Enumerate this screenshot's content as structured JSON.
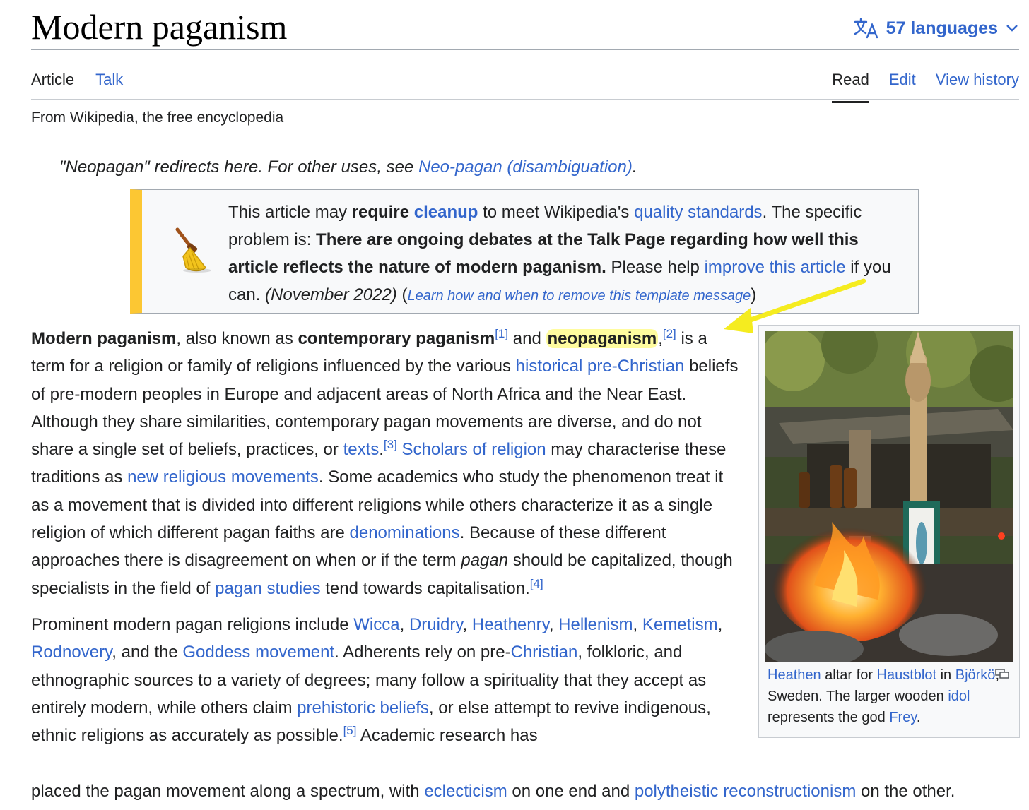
{
  "header": {
    "title": "Modern paganism",
    "languages_label": "57 languages"
  },
  "tabs": {
    "article": "Article",
    "talk": "Talk",
    "read": "Read",
    "edit": "Edit",
    "view_history": "View history"
  },
  "tagline": "From Wikipedia, the free encyclopedia",
  "hatnote": {
    "text": "\"Neopagan\" redirects here. For other uses, see ",
    "link": "Neo-pagan (disambiguation)",
    "end": "."
  },
  "ambox": {
    "t1": "This article may ",
    "b1": "require ",
    "l1": "cleanup",
    "t2": " to meet Wikipedia's ",
    "l2": "quality standards",
    "t3": ". The specific problem is: ",
    "b2": "There are ongoing debates at the Talk Page regarding how well this article reflects the nature of modern paganism.",
    "t4": " Please help ",
    "l3": "improve this article",
    "t5": " if you can. ",
    "date": "(November 2022)",
    "t6": " (",
    "l4": "Learn how and when to remove this template message",
    "t7": ")"
  },
  "p1": {
    "b1": "Modern paganism",
    "t1": ", also known as ",
    "b2": "contemporary paganism",
    "r1": "[1]",
    "t2": " and ",
    "b3": "neopaganism",
    "t3": ",",
    "r2": "[2]",
    "t4": " is a term for a religion or family of religions influenced by the various ",
    "l1": "historical pre-Christian",
    "t5": " beliefs of pre-modern peoples in Europe and adjacent areas of North Africa and the Near East. Although they share similarities, contemporary pagan movements are diverse, and do not share a single set of beliefs, practices, or ",
    "l2": "texts",
    "t6": ".",
    "r3": "[3]",
    "t7": " ",
    "l3": "Scholars of religion",
    "t8": " may characterise these traditions as ",
    "l4": "new religious movements",
    "t9": ". Some academics who study the phenomenon treat it as a movement that is divided into different religions while others characterize it as a single religion of which different pagan faiths are ",
    "l5": "denominations",
    "t10": ". Because of these different approaches there is disagreement on when or if the term ",
    "i1": "pagan",
    "t11": " should be capitalized, though specialists in the field of ",
    "l6": "pagan studies",
    "t12": " tend towards capitalisation.",
    "r4": "[4]"
  },
  "p2": {
    "t1": "Prominent modern pagan religions include ",
    "l1": "Wicca",
    "c1": ", ",
    "l2": "Druidry",
    "c2": ", ",
    "l3": "Heathenry",
    "c3": ", ",
    "l4": "Hellenism",
    "c4": ", ",
    "l5": "Kemetism",
    "c5": ", ",
    "l6": "Rodnovery",
    "t2": ", and the ",
    "l7": "Goddess movement",
    "t3": ". Adherents rely on pre-",
    "l8": "Christian",
    "t4": ", folkloric, and ethnographic sources to a variety of degrees; many follow a spirituality that they accept as entirely modern, while others claim ",
    "l9": "prehistoric beliefs",
    "t5": ", or else attempt to revive indigenous, ethnic religions as accurately as possible.",
    "r1": "[5]",
    "t6": " Academic research has"
  },
  "p3": {
    "t1": "placed the pagan movement along a spectrum, with ",
    "l1": "eclecticism",
    "t2": " on one end and ",
    "l2": "polytheistic reconstructionism",
    "t3": " on the other."
  },
  "infobox": {
    "l1": "Heathen",
    "t1": " altar for ",
    "l2": "Haustblot",
    "t2": " in ",
    "l3": "Björkö",
    "t3": ", Sweden. The larger wooden ",
    "l4": "idol",
    "t4": " represents the god ",
    "l5": "Frey",
    "t5": "."
  },
  "colors": {
    "link": "#3366cc",
    "ambox_accent": "#fcc733",
    "annotation": "#f5ec1f"
  },
  "icons": [
    "translate-icon",
    "chevron-down-icon",
    "broom-icon",
    "enlarge-icon"
  ]
}
